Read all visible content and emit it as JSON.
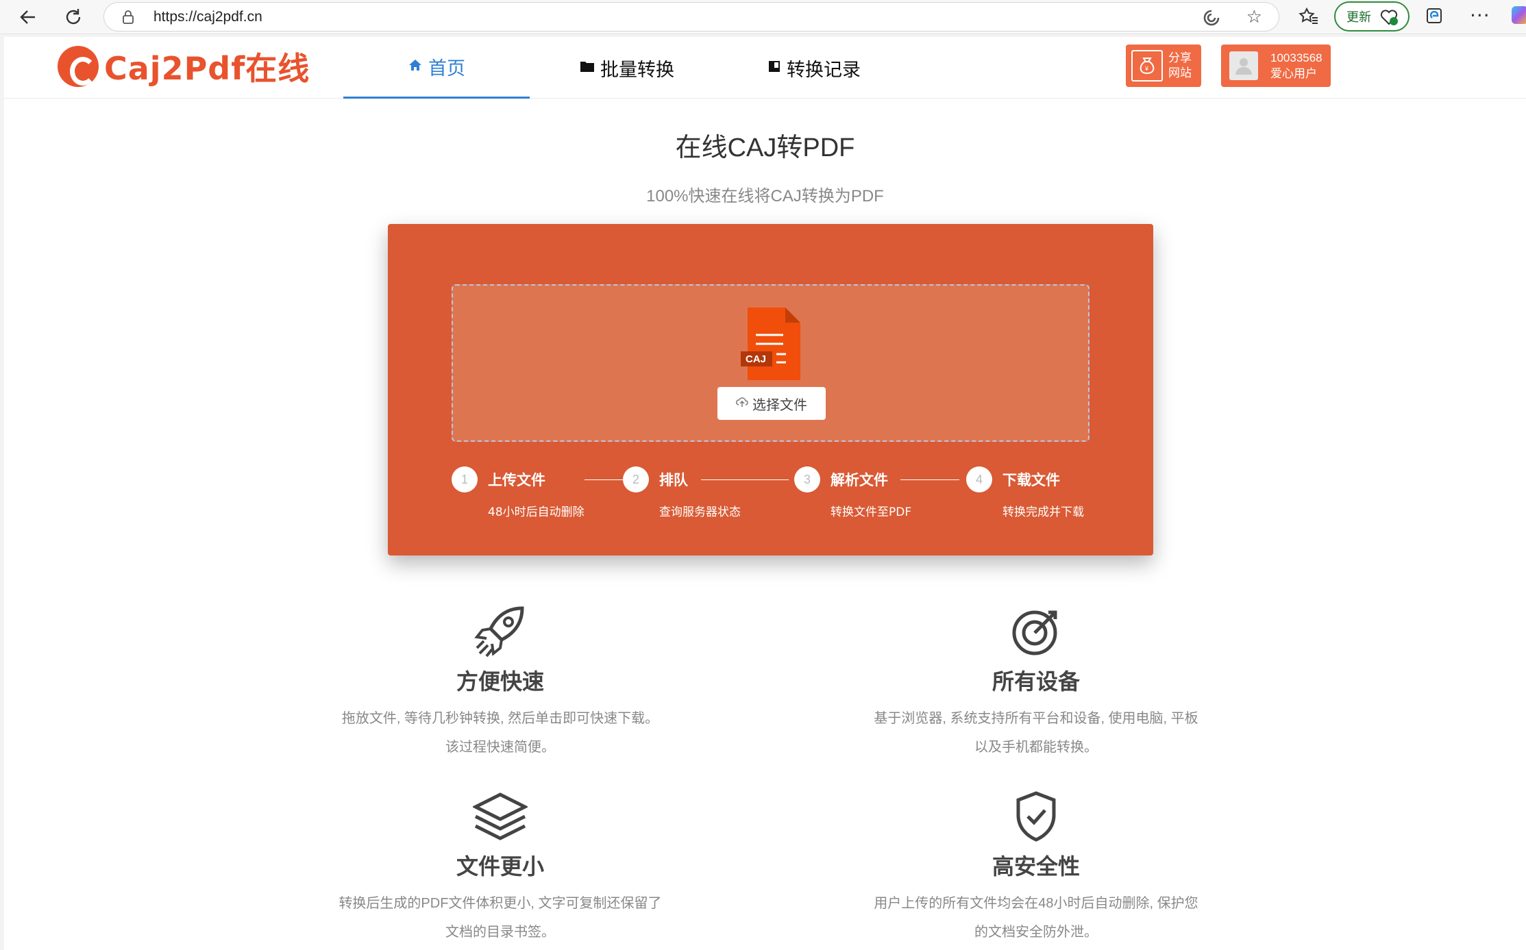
{
  "browser": {
    "url": "https://caj2pdf.cn",
    "update_label": "更新"
  },
  "header": {
    "logo_text": "Caj2Pdf在线",
    "tabs": [
      {
        "label": "首页",
        "icon": "home-icon"
      },
      {
        "label": "批量转换",
        "icon": "folder-icon"
      },
      {
        "label": "转换记录",
        "icon": "book-icon"
      }
    ],
    "share_label": "分享网站",
    "user_id": "10033568",
    "user_label": "爱心用户"
  },
  "main": {
    "title": "在线CAJ转PDF",
    "subtitle": "100%快速在线将CAJ转换为PDF"
  },
  "converter": {
    "file_badge": "CAJ",
    "choose_label": "选择文件",
    "steps": [
      {
        "num": "1",
        "name": "上传文件",
        "desc": "48小时后自动删除"
      },
      {
        "num": "2",
        "name": "排队",
        "desc": "查询服务器状态"
      },
      {
        "num": "3",
        "name": "解析文件",
        "desc": "转换文件至PDF"
      },
      {
        "num": "4",
        "name": "下载文件",
        "desc": "转换完成并下载"
      }
    ]
  },
  "features": [
    {
      "name": "方便快速",
      "line1": "拖放文件, 等待几秒钟转换, 然后单击即可快速下载。",
      "line2": "该过程快速简便。",
      "icon": "rocket-icon"
    },
    {
      "name": "所有设备",
      "line1": "基于浏览器, 系统支持所有平台和设备, 使用电脑, 平板",
      "line2": "以及手机都能转换。",
      "icon": "target-icon"
    },
    {
      "name": "文件更小",
      "line1": "转换后生成的PDF文件体积更小, 文字可复制还保留了",
      "line2": "文档的目录书签。",
      "icon": "layers-icon"
    },
    {
      "name": "高安全性",
      "line1": "用户上传的所有文件均会在48小时后自动删除, 保护您",
      "line2": "的文档安全防外泄。",
      "icon": "shield-check-icon"
    }
  ],
  "colors": {
    "brand": "#e8532e",
    "panel": "#d95a34",
    "active_tab": "#2f7fd6"
  }
}
